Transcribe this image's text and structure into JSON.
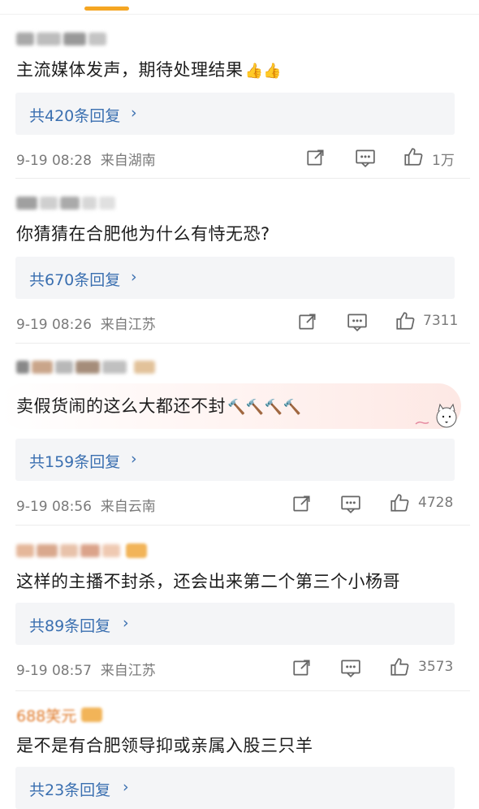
{
  "comments": [
    {
      "username": "",
      "content": "主流媒体发声，期待处理结果",
      "emoji": "👍👍",
      "reply_label": "共420条回复",
      "timestamp": "9-19 08:28",
      "location": "来自湖南",
      "likes": "1万"
    },
    {
      "username": "",
      "content": "你猜猜在合肥他为什么有恃无恐?",
      "emoji": "",
      "reply_label": "共670条回复",
      "timestamp": "9-19 08:26",
      "location": "来自江苏",
      "likes": "7311"
    },
    {
      "username": "",
      "content": "卖假货闹的这么大都还不封",
      "emoji": "🔨🔨🔨🔨",
      "reply_label": "共159条回复",
      "timestamp": "9-19 08:56",
      "location": "来自云南",
      "likes": "4728"
    },
    {
      "username": "",
      "content": "这样的主播不封杀，还会出来第二个第三个小杨哥",
      "emoji": "",
      "reply_label": "共89条回复",
      "timestamp": "9-19 08:57",
      "location": "来自江苏",
      "likes": "3573"
    },
    {
      "username": "688笑元",
      "content": "是不是有合肥领导抑或亲属入股三只羊",
      "emoji": "",
      "reply_label": "共23条回复",
      "timestamp": "",
      "location": "",
      "likes": ""
    }
  ],
  "reply_chevron": "›",
  "icons": {
    "share": "share-icon",
    "comment": "comment-icon",
    "like": "thumbs-up-icon"
  },
  "colors": {
    "accent": "#f5a623",
    "reply_link": "#3a6fb0",
    "meta": "#7a7a7a"
  }
}
